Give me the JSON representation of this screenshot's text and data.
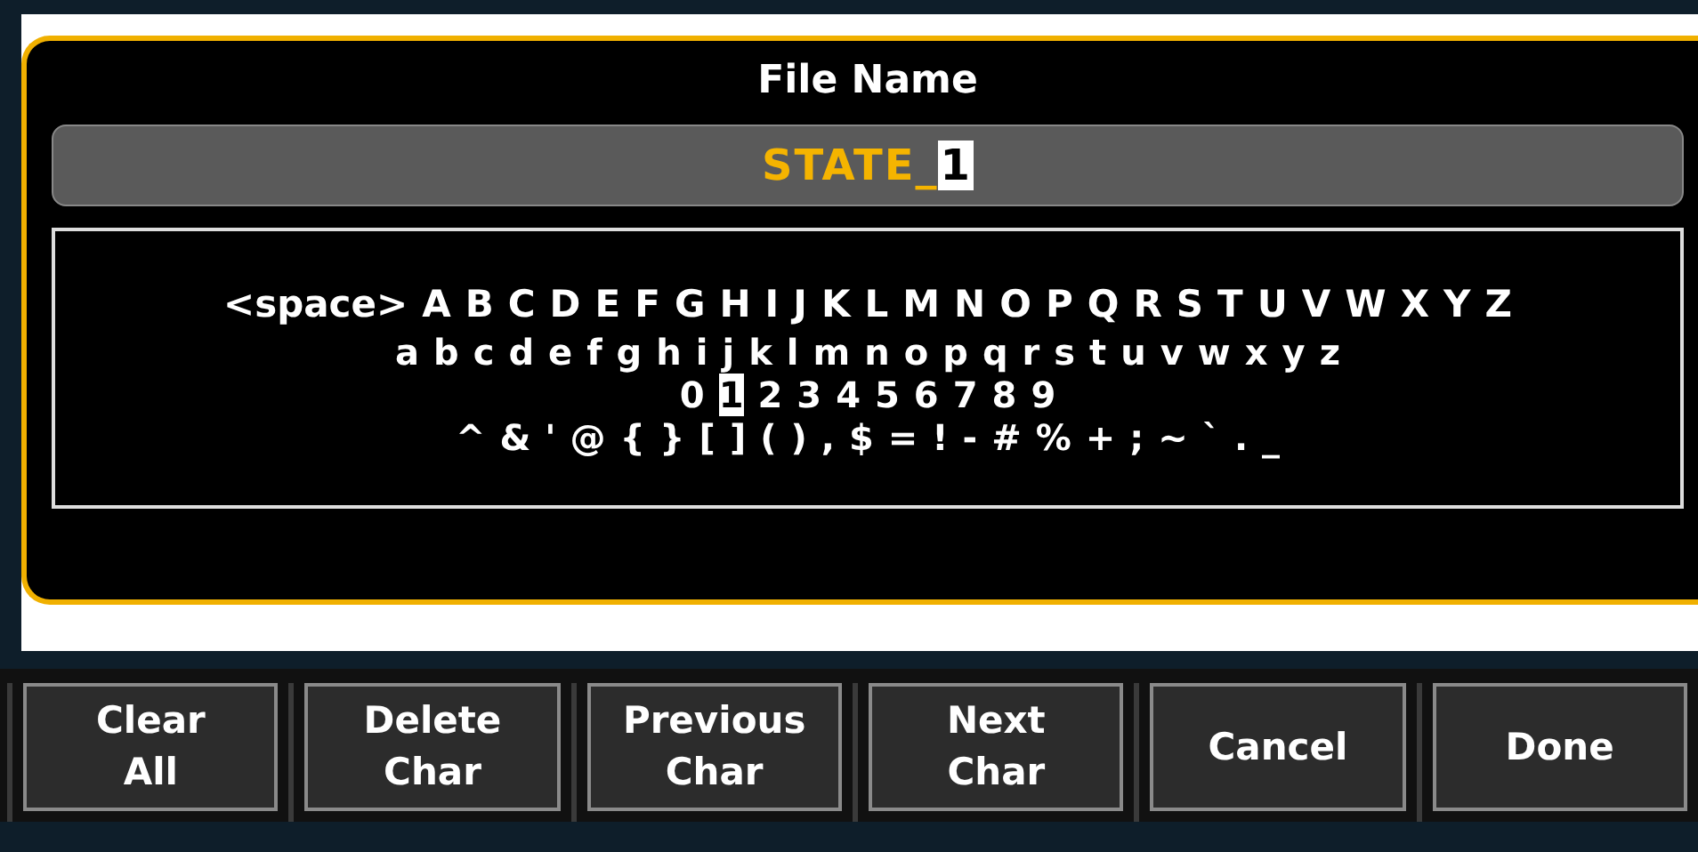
{
  "dialog": {
    "title": "File Name",
    "field": {
      "value": "STATE_",
      "cursor": "1"
    },
    "keyboard_rows": [
      [
        {
          "char": "<space>",
          "selected": false
        },
        {
          "char": "A",
          "selected": false
        },
        {
          "char": "B",
          "selected": false
        },
        {
          "char": "C",
          "selected": false
        },
        {
          "char": "D",
          "selected": false
        },
        {
          "char": "E",
          "selected": false
        },
        {
          "char": "F",
          "selected": false
        },
        {
          "char": "G",
          "selected": false
        },
        {
          "char": "H",
          "selected": false
        },
        {
          "char": "I",
          "selected": false
        },
        {
          "char": "J",
          "selected": false
        },
        {
          "char": "K",
          "selected": false
        },
        {
          "char": "L",
          "selected": false
        },
        {
          "char": "M",
          "selected": false
        },
        {
          "char": "N",
          "selected": false
        },
        {
          "char": "O",
          "selected": false
        },
        {
          "char": "P",
          "selected": false
        },
        {
          "char": "Q",
          "selected": false
        },
        {
          "char": "R",
          "selected": false
        },
        {
          "char": "S",
          "selected": false
        },
        {
          "char": "T",
          "selected": false
        },
        {
          "char": "U",
          "selected": false
        },
        {
          "char": "V",
          "selected": false
        },
        {
          "char": "W",
          "selected": false
        },
        {
          "char": "X",
          "selected": false
        },
        {
          "char": "Y",
          "selected": false
        },
        {
          "char": "Z",
          "selected": false
        }
      ],
      [
        {
          "char": "a",
          "selected": false
        },
        {
          "char": "b",
          "selected": false
        },
        {
          "char": "c",
          "selected": false
        },
        {
          "char": "d",
          "selected": false
        },
        {
          "char": "e",
          "selected": false
        },
        {
          "char": "f",
          "selected": false
        },
        {
          "char": "g",
          "selected": false
        },
        {
          "char": "h",
          "selected": false
        },
        {
          "char": "i",
          "selected": false
        },
        {
          "char": "j",
          "selected": false
        },
        {
          "char": "k",
          "selected": false
        },
        {
          "char": "l",
          "selected": false
        },
        {
          "char": "m",
          "selected": false
        },
        {
          "char": "n",
          "selected": false
        },
        {
          "char": "o",
          "selected": false
        },
        {
          "char": "p",
          "selected": false
        },
        {
          "char": "q",
          "selected": false
        },
        {
          "char": "r",
          "selected": false
        },
        {
          "char": "s",
          "selected": false
        },
        {
          "char": "t",
          "selected": false
        },
        {
          "char": "u",
          "selected": false
        },
        {
          "char": "v",
          "selected": false
        },
        {
          "char": "w",
          "selected": false
        },
        {
          "char": "x",
          "selected": false
        },
        {
          "char": "y",
          "selected": false
        },
        {
          "char": "z",
          "selected": false
        }
      ],
      [
        {
          "char": "0",
          "selected": false
        },
        {
          "char": "1",
          "selected": true
        },
        {
          "char": "2",
          "selected": false
        },
        {
          "char": "3",
          "selected": false
        },
        {
          "char": "4",
          "selected": false
        },
        {
          "char": "5",
          "selected": false
        },
        {
          "char": "6",
          "selected": false
        },
        {
          "char": "7",
          "selected": false
        },
        {
          "char": "8",
          "selected": false
        },
        {
          "char": "9",
          "selected": false
        }
      ],
      [
        {
          "char": "^",
          "selected": false
        },
        {
          "char": "&",
          "selected": false
        },
        {
          "char": "'",
          "selected": false
        },
        {
          "char": "@",
          "selected": false
        },
        {
          "char": "{",
          "selected": false
        },
        {
          "char": "}",
          "selected": false
        },
        {
          "char": "[",
          "selected": false
        },
        {
          "char": "]",
          "selected": false
        },
        {
          "char": "(",
          "selected": false
        },
        {
          "char": ")",
          "selected": false
        },
        {
          "char": ",",
          "selected": false
        },
        {
          "char": "$",
          "selected": false
        },
        {
          "char": "=",
          "selected": false
        },
        {
          "char": "!",
          "selected": false
        },
        {
          "char": "-",
          "selected": false
        },
        {
          "char": "#",
          "selected": false
        },
        {
          "char": "%",
          "selected": false
        },
        {
          "char": "+",
          "selected": false
        },
        {
          "char": ";",
          "selected": false
        },
        {
          "char": "~",
          "selected": false
        },
        {
          "char": "`",
          "selected": false
        },
        {
          "char": ".",
          "selected": false
        },
        {
          "char": "_",
          "selected": false
        }
      ]
    ]
  },
  "softkeys": [
    {
      "lines": [
        "Clear",
        "All"
      ]
    },
    {
      "lines": [
        "Delete",
        "Char"
      ]
    },
    {
      "lines": [
        "Previous",
        "Char"
      ]
    },
    {
      "lines": [
        "Next",
        "Char"
      ]
    },
    {
      "lines": [
        "Cancel"
      ]
    },
    {
      "lines": [
        "Done"
      ]
    }
  ]
}
